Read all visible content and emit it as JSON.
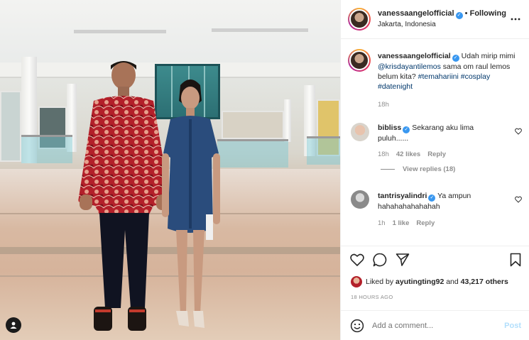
{
  "post": {
    "author": "vanessaangelofficial",
    "following_label": "Following",
    "location": "Jakarta, Indonesia",
    "more_icon": "more-horizontal-icon"
  },
  "caption": {
    "author": "vanessaangelofficial",
    "text_before": "Udah mirip mimi",
    "mention": "@krisdayantilemos",
    "text_after": "sama om raul lemos belum kita?",
    "hashtags": [
      "#temahariini",
      "#cosplay",
      "#datenight"
    ],
    "time": "18h"
  },
  "comments": [
    {
      "author": "bibliss",
      "text": "Sekarang aku lima puluh......",
      "time": "18h",
      "likes": "42 likes",
      "reply": "Reply"
    },
    {
      "author": "tantrisyalindri",
      "text": "Ya ampun hahahahahahahah",
      "time": "1h",
      "likes": "1 like",
      "reply": "Reply"
    }
  ],
  "view_replies": "View replies (18)",
  "likes_line": {
    "prefix": "Liked by",
    "user": "ayutingting92",
    "and": "and",
    "count": "43,217 others"
  },
  "posted_ago": "18 HOURS AGO",
  "add_comment": {
    "placeholder": "Add a comment...",
    "post_label": "Post"
  },
  "colors": {
    "verified": "#3897f0",
    "link": "#00376b",
    "post_button": "#b2dffc",
    "batik_red": "#b3202a"
  }
}
